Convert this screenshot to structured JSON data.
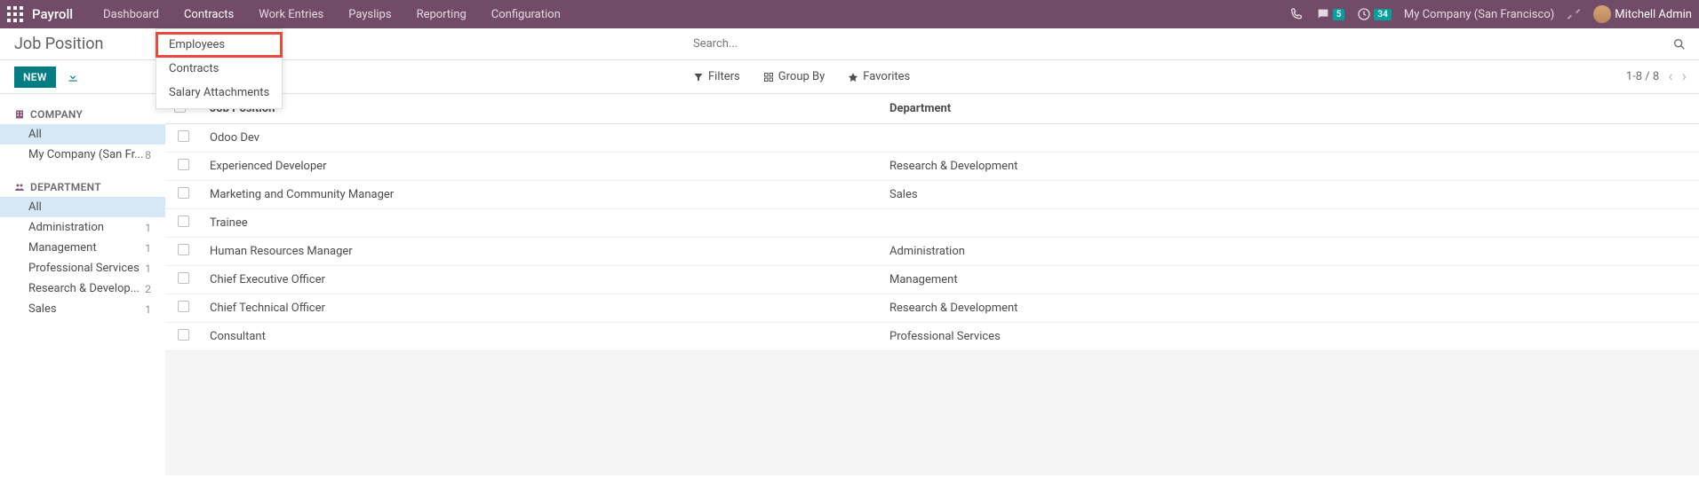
{
  "app_name": "Payroll",
  "nav": {
    "dashboard": "Dashboard",
    "contracts": "Contracts",
    "work_entries": "Work Entries",
    "payslips": "Payslips",
    "reporting": "Reporting",
    "configuration": "Configuration"
  },
  "dropdown": {
    "employees": "Employees",
    "contracts": "Contracts",
    "salary_attachments": "Salary Attachments"
  },
  "header": {
    "chat_badge": "5",
    "clock_badge": "34",
    "company": "My Company (San Francisco)",
    "user": "Mitchell Admin"
  },
  "breadcrumb": "Job Position",
  "search_placeholder": "Search...",
  "toolbar": {
    "new": "NEW",
    "filters": "Filters",
    "group_by": "Group By",
    "favorites": "Favorites",
    "pager": "1-8 / 8"
  },
  "sidebar": {
    "company_label": "COMPANY",
    "company_items": [
      {
        "label": "All",
        "count": ""
      },
      {
        "label": "My Company (San Fr...",
        "count": "8"
      }
    ],
    "department_label": "DEPARTMENT",
    "department_items": [
      {
        "label": "All",
        "count": ""
      },
      {
        "label": "Administration",
        "count": "1"
      },
      {
        "label": "Management",
        "count": "1"
      },
      {
        "label": "Professional Services",
        "count": "1"
      },
      {
        "label": "Research & Develop...",
        "count": "2"
      },
      {
        "label": "Sales",
        "count": "1"
      }
    ]
  },
  "table": {
    "col_position": "Job Position",
    "col_department": "Department",
    "rows": [
      {
        "position": "Odoo Dev",
        "department": ""
      },
      {
        "position": "Experienced Developer",
        "department": "Research & Development"
      },
      {
        "position": "Marketing and Community Manager",
        "department": "Sales"
      },
      {
        "position": "Trainee",
        "department": ""
      },
      {
        "position": "Human Resources Manager",
        "department": "Administration"
      },
      {
        "position": "Chief Executive Officer",
        "department": "Management"
      },
      {
        "position": "Chief Technical Officer",
        "department": "Research & Development"
      },
      {
        "position": "Consultant",
        "department": "Professional Services"
      }
    ]
  }
}
